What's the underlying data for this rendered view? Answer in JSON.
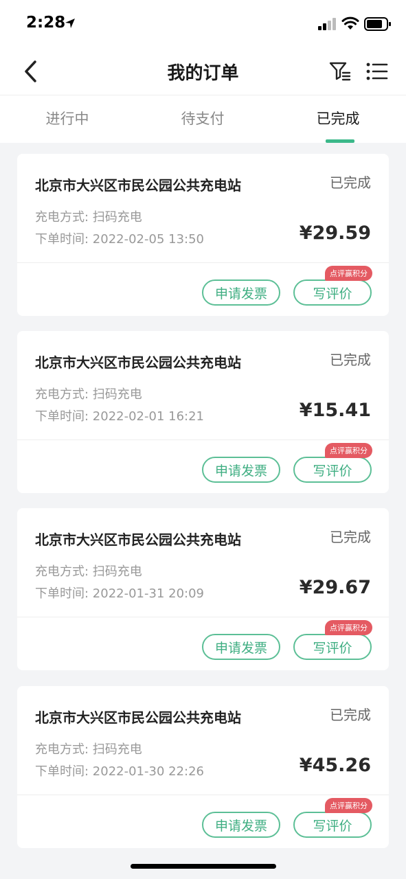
{
  "status_bar": {
    "time": "2:28",
    "icons": [
      "location-arrow-icon",
      "signal-icon",
      "wifi-icon",
      "battery-icon"
    ]
  },
  "nav": {
    "title": "我的订单",
    "back_icon": "chevron-left-icon",
    "filter_icon": "filter-icon",
    "menu_icon": "list-icon"
  },
  "tabs": [
    {
      "label": "进行中",
      "active": false
    },
    {
      "label": "待支付",
      "active": false
    },
    {
      "label": "已完成",
      "active": true
    }
  ],
  "colors": {
    "accent": "#3bb88a",
    "badge": "#e45a62",
    "background": "#f3f4f6"
  },
  "orders": [
    {
      "station": "北京市大兴区市民公园公共充电站",
      "status": "已完成",
      "method": "充电方式: 扫码充电",
      "time": "下单时间: 2022-02-05 13:50",
      "price": "¥29.59",
      "invoice_label": "申请发票",
      "review_label": "写评价",
      "badge": "点评赢积分"
    },
    {
      "station": "北京市大兴区市民公园公共充电站",
      "status": "已完成",
      "method": "充电方式: 扫码充电",
      "time": "下单时间: 2022-02-01 16:21",
      "price": "¥15.41",
      "invoice_label": "申请发票",
      "review_label": "写评价",
      "badge": "点评赢积分"
    },
    {
      "station": "北京市大兴区市民公园公共充电站",
      "status": "已完成",
      "method": "充电方式: 扫码充电",
      "time": "下单时间: 2022-01-31 20:09",
      "price": "¥29.67",
      "invoice_label": "申请发票",
      "review_label": "写评价",
      "badge": "点评赢积分"
    },
    {
      "station": "北京市大兴区市民公园公共充电站",
      "status": "已完成",
      "method": "充电方式: 扫码充电",
      "time": "下单时间: 2022-01-30 22:26",
      "price": "¥45.26",
      "invoice_label": "申请发票",
      "review_label": "写评价",
      "badge": "点评赢积分"
    }
  ]
}
